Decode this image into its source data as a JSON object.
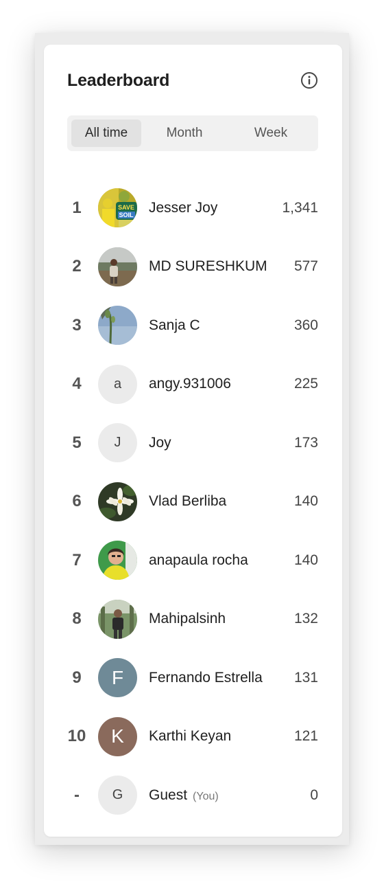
{
  "leaderboard": {
    "title": "Leaderboard",
    "info_icon": "info-icon",
    "tabs": [
      {
        "label": "All time",
        "active": true
      },
      {
        "label": "Month",
        "active": false
      },
      {
        "label": "Week",
        "active": false
      }
    ],
    "entries": [
      {
        "rank": "1",
        "name": "Jesser Joy",
        "score": "1,341",
        "avatar": "photo-save-soil"
      },
      {
        "rank": "2",
        "name": "MD SURESHKUM",
        "score": "577",
        "avatar": "photo-person-field"
      },
      {
        "rank": "3",
        "name": "Sanja C",
        "score": "360",
        "avatar": "photo-plant-sky"
      },
      {
        "rank": "4",
        "name": "angy.931006",
        "score": "225",
        "avatar_letter": "a"
      },
      {
        "rank": "5",
        "name": "Joy",
        "score": "173",
        "avatar_letter": "J"
      },
      {
        "rank": "6",
        "name": "Vlad Berliba",
        "score": "140",
        "avatar": "photo-white-lily"
      },
      {
        "rank": "7",
        "name": "anapaula rocha",
        "score": "140",
        "avatar": "photo-person-green"
      },
      {
        "rank": "8",
        "name": "Mahipalsinh",
        "score": "132",
        "avatar": "photo-person-trees"
      },
      {
        "rank": "9",
        "name": "Fernando Estrella",
        "score": "131",
        "avatar_letter": "F",
        "avatar_color": "#6f8a97"
      },
      {
        "rank": "10",
        "name": "Karthi Keyan",
        "score": "121",
        "avatar_letter": "K",
        "avatar_color": "#8a6a5c"
      },
      {
        "rank": "-",
        "name": "Guest",
        "score": "0",
        "avatar_letter": "G",
        "you_label": "(You)"
      }
    ]
  }
}
